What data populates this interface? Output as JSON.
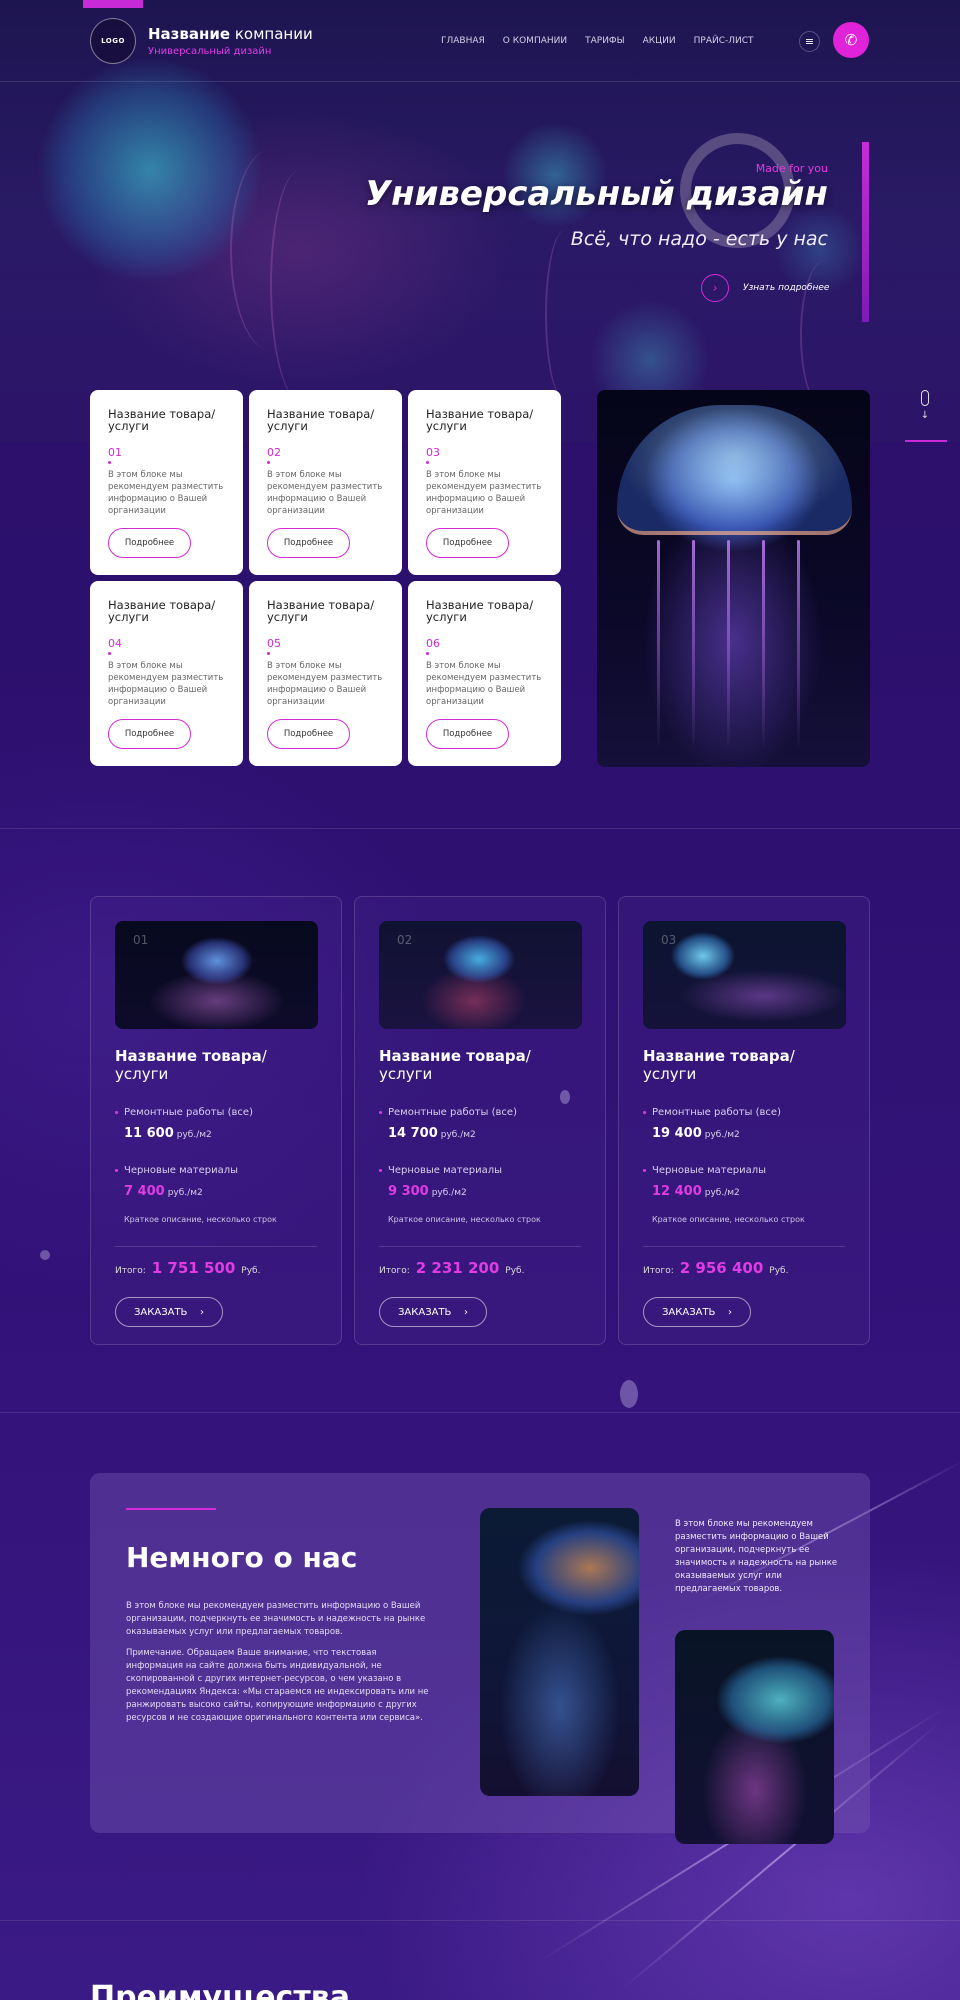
{
  "header": {
    "logo_text": "LOGO",
    "brand_bold": "Название",
    "brand_rest": " компании",
    "brand_sub": "Универсальный дизайн",
    "nav": [
      "ГЛАВНАЯ",
      "О КОМПАНИИ",
      "ТАРИФЫ",
      "АКЦИИ",
      "ПРАЙС-ЛИСТ"
    ],
    "menu_icon": "hamburger-icon",
    "call_icon": "phone-icon"
  },
  "hero": {
    "tag": "Made for you",
    "title": "Универсальный дизайн",
    "subtitle": "Всё, что надо - есть у нас",
    "more_label": "Узнать подробнее"
  },
  "services": [
    {
      "title": "Название товара/ услуги",
      "num": "01",
      "text": "В этом блоке мы рекомендуем разместить информацию о Вашей организации",
      "button": "Подробнее"
    },
    {
      "title": "Название товара/ услуги",
      "num": "02",
      "text": "В этом блоке мы рекомендуем разместить информацию о Вашей организации",
      "button": "Подробнее"
    },
    {
      "title": "Название товара/ услуги",
      "num": "03",
      "text": "В этом блоке мы рекомендуем разместить информацию о Вашей организации",
      "button": "Подробнее"
    },
    {
      "title": "Название товара/ услуги",
      "num": "04",
      "text": "В этом блоке мы рекомендуем разместить информацию о Вашей организации",
      "button": "Подробнее"
    },
    {
      "title": "Название товара/ услуги",
      "num": "05",
      "text": "В этом блоке мы рекомендуем разместить информацию о Вашей организации",
      "button": "Подробнее"
    },
    {
      "title": "Название товара/ услуги",
      "num": "06",
      "text": "В этом блоке мы рекомендуем разместить информацию о Вашей организации",
      "button": "Подробнее"
    }
  ],
  "pricing": [
    {
      "num": "01",
      "title_bold": "Название товара",
      "title_rest": "/услуги",
      "line1": "Ремонтные работы (все)",
      "val1": "11 600",
      "line2": "Черновые материалы",
      "val2": "7 400",
      "unit": "руб./м2",
      "desc": "Краткое описание, несколько строк",
      "total_label": "Итого:",
      "total": "1 751 500",
      "currency": "Руб.",
      "order": "ЗАКАЗАТЬ"
    },
    {
      "num": "02",
      "title_bold": "Название товара",
      "title_rest": "/услуги",
      "line1": "Ремонтные работы (все)",
      "val1": "14 700",
      "line2": "Черновые материалы",
      "val2": "9 300",
      "unit": "руб./м2",
      "desc": "Краткое описание, несколько строк",
      "total_label": "Итого:",
      "total": "2 231 200",
      "currency": "Руб.",
      "order": "ЗАКАЗАТЬ"
    },
    {
      "num": "03",
      "title_bold": "Название товара",
      "title_rest": "/услуги",
      "line1": "Ремонтные работы (все)",
      "val1": "19 400",
      "line2": "Черновые материалы",
      "val2": "12 400",
      "unit": "руб./м2",
      "desc": "Краткое описание, несколько строк",
      "total_label": "Итого:",
      "total": "2 956 400",
      "currency": "Руб.",
      "order": "ЗАКАЗАТЬ"
    }
  ],
  "about": {
    "title": "Немного о нас",
    "p1": "В этом блоке мы рекомендуем разместить информацию о Вашей организации, подчеркнуть ее значимость и надежность на рынке оказываемых услуг или предлагаемых товаров.",
    "p2": "Примечание. Обращаем Ваше внимание, что текстовая информация на сайте должна быть индивидуальной, не скопированной с других интернет-ресурсов, о чем указано в рекомендациях Яндекса: «Мы стараемся не индексировать или не ранжировать высоко сайты, копирующие информацию с других ресурсов и не создающие оригинального контента или сервиса».",
    "side_text": "В этом блоке мы рекомендуем разместить информацию о Вашей организации, подчеркнуть ее значимость и надежность на рынке оказываемых услуг или предлагаемых товаров."
  },
  "advantages": {
    "title": "Преимущества"
  },
  "colors": {
    "accent": "#e022d9",
    "background": "#2b0f66",
    "card": "#ffffff"
  }
}
